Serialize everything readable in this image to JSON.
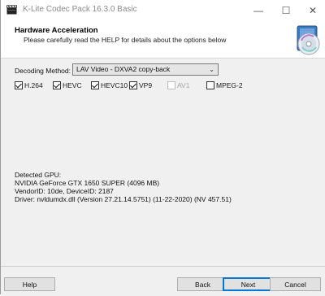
{
  "window": {
    "title": "K-Lite Codec Pack 16.3.0 Basic",
    "controls": {
      "minimize": "—",
      "maximize": "☐",
      "close": "✕"
    }
  },
  "header": {
    "title": "Hardware Acceleration",
    "subtitle": "Please carefully read the HELP for details about the options below"
  },
  "decoding": {
    "label": "Decoding Method:",
    "selected": "LAV Video - DXVA2 copy-back"
  },
  "codecs": [
    {
      "label": "H.264",
      "checked": true,
      "enabled": true
    },
    {
      "label": "HEVC",
      "checked": true,
      "enabled": true
    },
    {
      "label": "HEVC10",
      "checked": true,
      "enabled": true
    },
    {
      "label": "VP9",
      "checked": true,
      "enabled": true
    },
    {
      "label": "AV1",
      "checked": false,
      "enabled": false
    },
    {
      "label": "MPEG-2",
      "checked": false,
      "enabled": true
    }
  ],
  "gpu": {
    "line1": "Detected GPU:",
    "line2": "NVIDIA GeForce GTX 1650 SUPER (4096 MB)",
    "line3": "VendorID: 10de, DeviceID: 2187",
    "line4": "Driver: nvldumdx.dll (Version 27.21.14.5751) (11-22-2020) (NV 457.51)"
  },
  "footer": {
    "help": "Help",
    "back": "Back",
    "next": "Next",
    "cancel": "Cancel"
  },
  "colors": {
    "accent": "#0078d7",
    "window_bg": "#f0f0f0",
    "header_bg": "#ffffff"
  }
}
